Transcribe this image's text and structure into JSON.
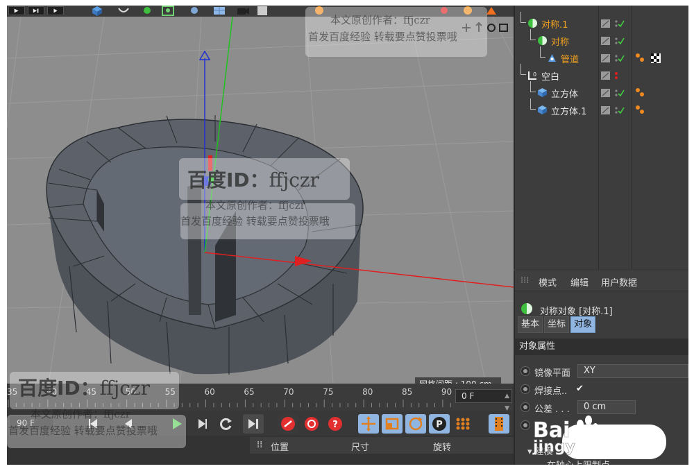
{
  "viewport": {
    "grid_spacing": "网格间距 : 100 cm"
  },
  "timeline": {
    "ticks": [
      "35",
      "40",
      "45",
      "50",
      "55",
      "60",
      "65",
      "70",
      "75",
      "80",
      "85",
      "90"
    ],
    "current_frame": "0 F",
    "end_frame": "90 F"
  },
  "coordinates": {
    "headers": [
      "位置",
      "尺寸",
      "旋转"
    ]
  },
  "object_manager": {
    "objects": [
      {
        "name": "对称.1",
        "icon": "symmetry-icon",
        "color": "#f0a020",
        "tags": []
      },
      {
        "name": "对称",
        "icon": "symmetry-icon",
        "color": "#f0a020",
        "tags": []
      },
      {
        "name": "管道",
        "icon": "tube-icon",
        "color": "#f0a020",
        "tags": [
          "phong-tag-icon",
          "checker-texture-tag-icon"
        ]
      },
      {
        "name": "空白",
        "icon": "null-object-icon",
        "color": "#e6e6e6",
        "tags": []
      },
      {
        "name": "立方体",
        "icon": "cube-icon",
        "color": "#e6e6e6",
        "tags": [
          "phong-tag-icon"
        ]
      },
      {
        "name": "立方体.1",
        "icon": "cube-icon",
        "color": "#e6e6e6",
        "tags": [
          "phong-tag-icon"
        ]
      }
    ]
  },
  "attribute_manager": {
    "menu": [
      "模式",
      "编辑",
      "用户数据"
    ],
    "title": "对称对象 [对称.1]",
    "tabs": [
      "基本",
      "坐标",
      "对象"
    ],
    "active_tab": "对象",
    "section": "对象属性",
    "properties": [
      {
        "label": "镜像平面",
        "value": "XY"
      },
      {
        "label": "焊接点..",
        "value": "✔"
      },
      {
        "label": "公差 . . .",
        "value": "0 cm"
      },
      {
        "label": "",
        "value": ""
      }
    ],
    "subsection": "▾ 建模",
    "sub_property": "在轴心上限制点 . . ."
  },
  "watermarks": {
    "small_author": "本文原创作者：ffjczr",
    "small_slogan": "首发百度经验  转载要点赞投票哦",
    "big_id_prefix": "百度ID：",
    "big_id": "ffjczr",
    "baidu_text": "jingy"
  },
  "colors": {
    "selected_object": "#f0a020",
    "active_tab": "#8fb5e0",
    "viewport_bg": "#8d8d8d",
    "x_axis": "#e02020",
    "y_axis": "#20c020",
    "z_axis": "#2030d0"
  }
}
